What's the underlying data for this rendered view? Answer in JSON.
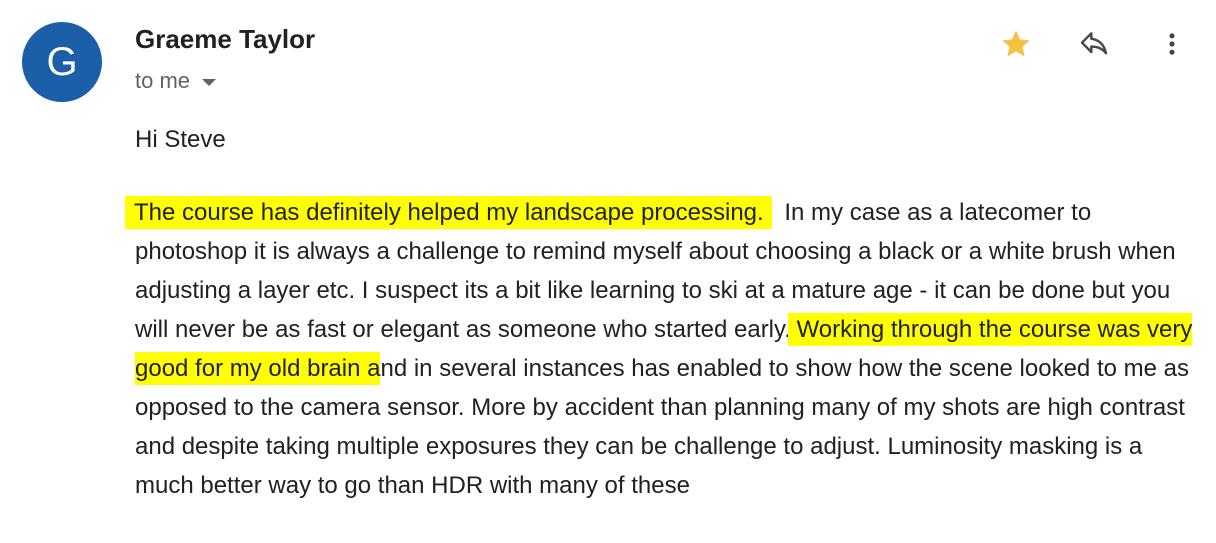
{
  "sender": {
    "initial": "G",
    "name": "Graeme Taylor",
    "recipient_label": "to me",
    "avatar_color": "#1a5fa8"
  },
  "actions": {
    "star_icon": "star-icon",
    "star_color": "#f6c244",
    "reply_icon": "reply-icon",
    "more_icon": "more-vert-icon"
  },
  "message": {
    "greeting": "Hi Steve",
    "highlight_1": "The course has definitely helped my landscape processing.",
    "text_1": " In my case as a latecomer to photoshop it is always a challenge to remind myself about choosing a black or a white brush when adjusting a layer etc.   I suspect its a bit like learning to ski at a mature age - it can be done but you will never be as fast or elegant as someone who started early. ",
    "highlight_2": "Working through the course was very good for my old brain a",
    "text_2": "nd in several instances has enabled to show how the scene looked to me as opposed to the camera sensor.   More by accident than planning many of my shots are high contrast and despite taking multiple exposures they can be challenge to adjust.  Luminosity masking is a much better way to go than HDR with many of these",
    "highlight_color": "#ffff00"
  }
}
